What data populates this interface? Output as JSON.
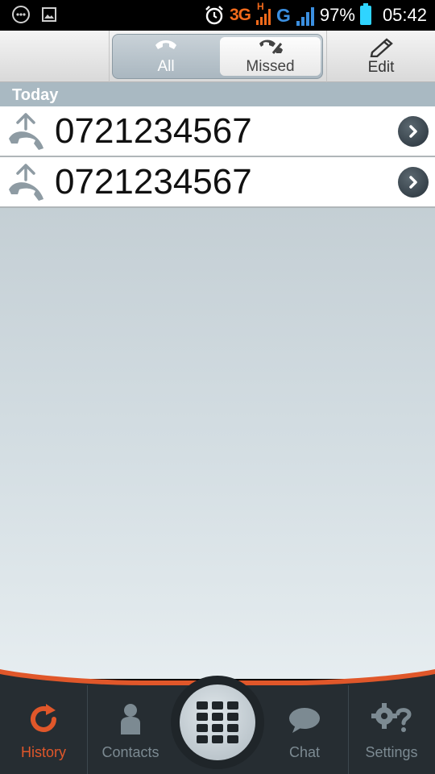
{
  "status_bar": {
    "network_3g": "3G",
    "network_h": "H",
    "network_g": "G",
    "battery": "97%",
    "time": "05:42",
    "icons": [
      "notification-icon",
      "image-icon",
      "alarm-icon",
      "signal-3g-icon",
      "signal-g-icon",
      "battery-icon"
    ]
  },
  "action_bar": {
    "tabs": [
      {
        "label": "All",
        "icon": "phone-icon",
        "selected": false
      },
      {
        "label": "Missed",
        "icon": "missed-call-icon",
        "selected": true
      }
    ],
    "edit_label": "Edit"
  },
  "history": {
    "section_title": "Today",
    "calls": [
      {
        "number": "0721234567",
        "type": "outgoing-call-icon"
      },
      {
        "number": "0721234567",
        "type": "outgoing-call-icon"
      }
    ]
  },
  "bottom_nav": {
    "tabs": [
      {
        "label": "History",
        "icon": "history-icon",
        "active": true
      },
      {
        "label": "Contacts",
        "icon": "contacts-icon",
        "active": false
      },
      {
        "label": "Chat",
        "icon": "chat-icon",
        "active": false
      },
      {
        "label": "Settings",
        "icon": "settings-icon",
        "active": false
      }
    ],
    "center_icon": "dialpad-icon"
  },
  "colors": {
    "accent": "#e0572a",
    "header": "#a9b9c2",
    "nav_bg": "#262d32",
    "battery": "#2fd4ff",
    "network": "#f26a1b"
  }
}
